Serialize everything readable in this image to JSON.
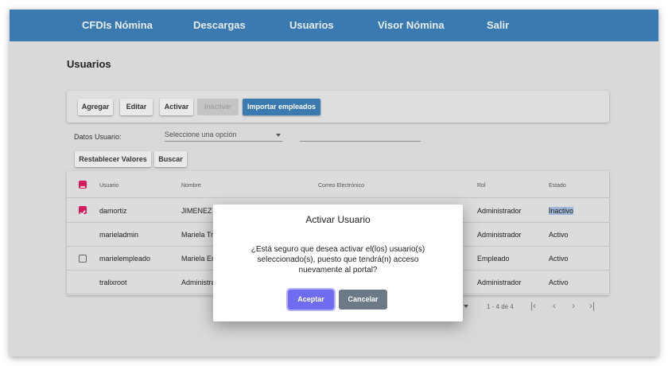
{
  "nav": {
    "items": [
      "CFDIs Nómina",
      "Descargas",
      "Usuarios",
      "Visor Nómina",
      "Salir"
    ]
  },
  "page": {
    "title": "Usuarios"
  },
  "toolbar": {
    "add": "Agregar",
    "edit": "Editar",
    "activate": "Activar",
    "deactivate": "Inactivar",
    "import": "Importar empleados"
  },
  "filters": {
    "label": "Datos Usuario:",
    "select_value": "Seleccione una opción",
    "text_value": "",
    "reset": "Restablecer Valores",
    "search": "Buscar"
  },
  "table": {
    "headers": [
      "Usuario",
      "Nombre",
      "Correo Electrónico",
      "Rol",
      "Estado"
    ],
    "rows": [
      {
        "checkbox": "checked",
        "usuario": "damortiz",
        "nombre": "JIMENEZ E",
        "rol": "Administrador",
        "estado": "Inactivo"
      },
      {
        "checkbox": "none",
        "usuario": "marieladmin",
        "nombre": "Mariela Tr",
        "rol": "Administrador",
        "estado": "Activo"
      },
      {
        "checkbox": "unchecked",
        "usuario": "marielempleado",
        "nombre": "Mariela Em",
        "rol": "Empleado",
        "estado": "Activo"
      },
      {
        "checkbox": "none",
        "usuario": "tralixroot",
        "nombre": "Administra",
        "rol": "Administrador",
        "estado": "Activo"
      }
    ]
  },
  "pagination": {
    "range": "1 - 4 de 4",
    "icons": [
      "first-page-icon",
      "prev-page-icon",
      "next-page-icon",
      "last-page-icon"
    ]
  },
  "dialog": {
    "title": "Activar Usuario",
    "message_line1": "¿Está seguro que desea activar el(los) usuario(s)",
    "message_line2": "seleccionado(s), puesto que tendrá(n) acceso",
    "message_line3": "nuevamente al portal?",
    "accept": "Aceptar",
    "cancel": "Cancelar"
  },
  "colors": {
    "nav_bg": "#3a7ab0",
    "accent_checkbox": "#d81b60",
    "accept_button": "#6f6cf0",
    "cancel_button": "#6b7a86"
  }
}
